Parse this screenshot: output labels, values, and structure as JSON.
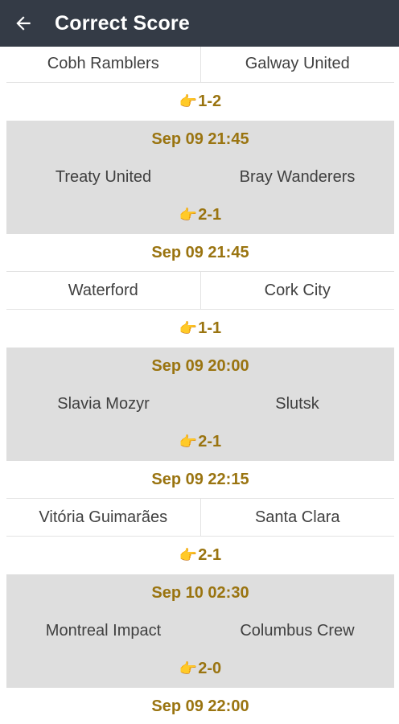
{
  "appbar": {
    "title": "Correct Score",
    "back_icon": "arrow-left-icon"
  },
  "colors": {
    "appbar_bg": "#343b46",
    "accent_gold": "#9a7410",
    "gray_row": "#dedede"
  },
  "tips": [
    {
      "time": "",
      "home": "Cobh Ramblers",
      "away": "Galway United",
      "score": "1-2"
    },
    {
      "time": "Sep 09 21:45",
      "home": "Treaty United",
      "away": "Bray Wanderers",
      "score": "2-1"
    },
    {
      "time": "Sep 09 21:45",
      "home": "Waterford",
      "away": "Cork City",
      "score": "1-1"
    },
    {
      "time": "Sep 09 20:00",
      "home": "Slavia Mozyr",
      "away": "Slutsk",
      "score": "2-1"
    },
    {
      "time": "Sep 09 22:15",
      "home": "Vitória Guimarães",
      "away": "Santa Clara",
      "score": "2-1"
    },
    {
      "time": "Sep 10 02:30",
      "home": "Montreal Impact",
      "away": "Columbus Crew",
      "score": "2-0"
    },
    {
      "time": "Sep 09 22:00"
    }
  ]
}
